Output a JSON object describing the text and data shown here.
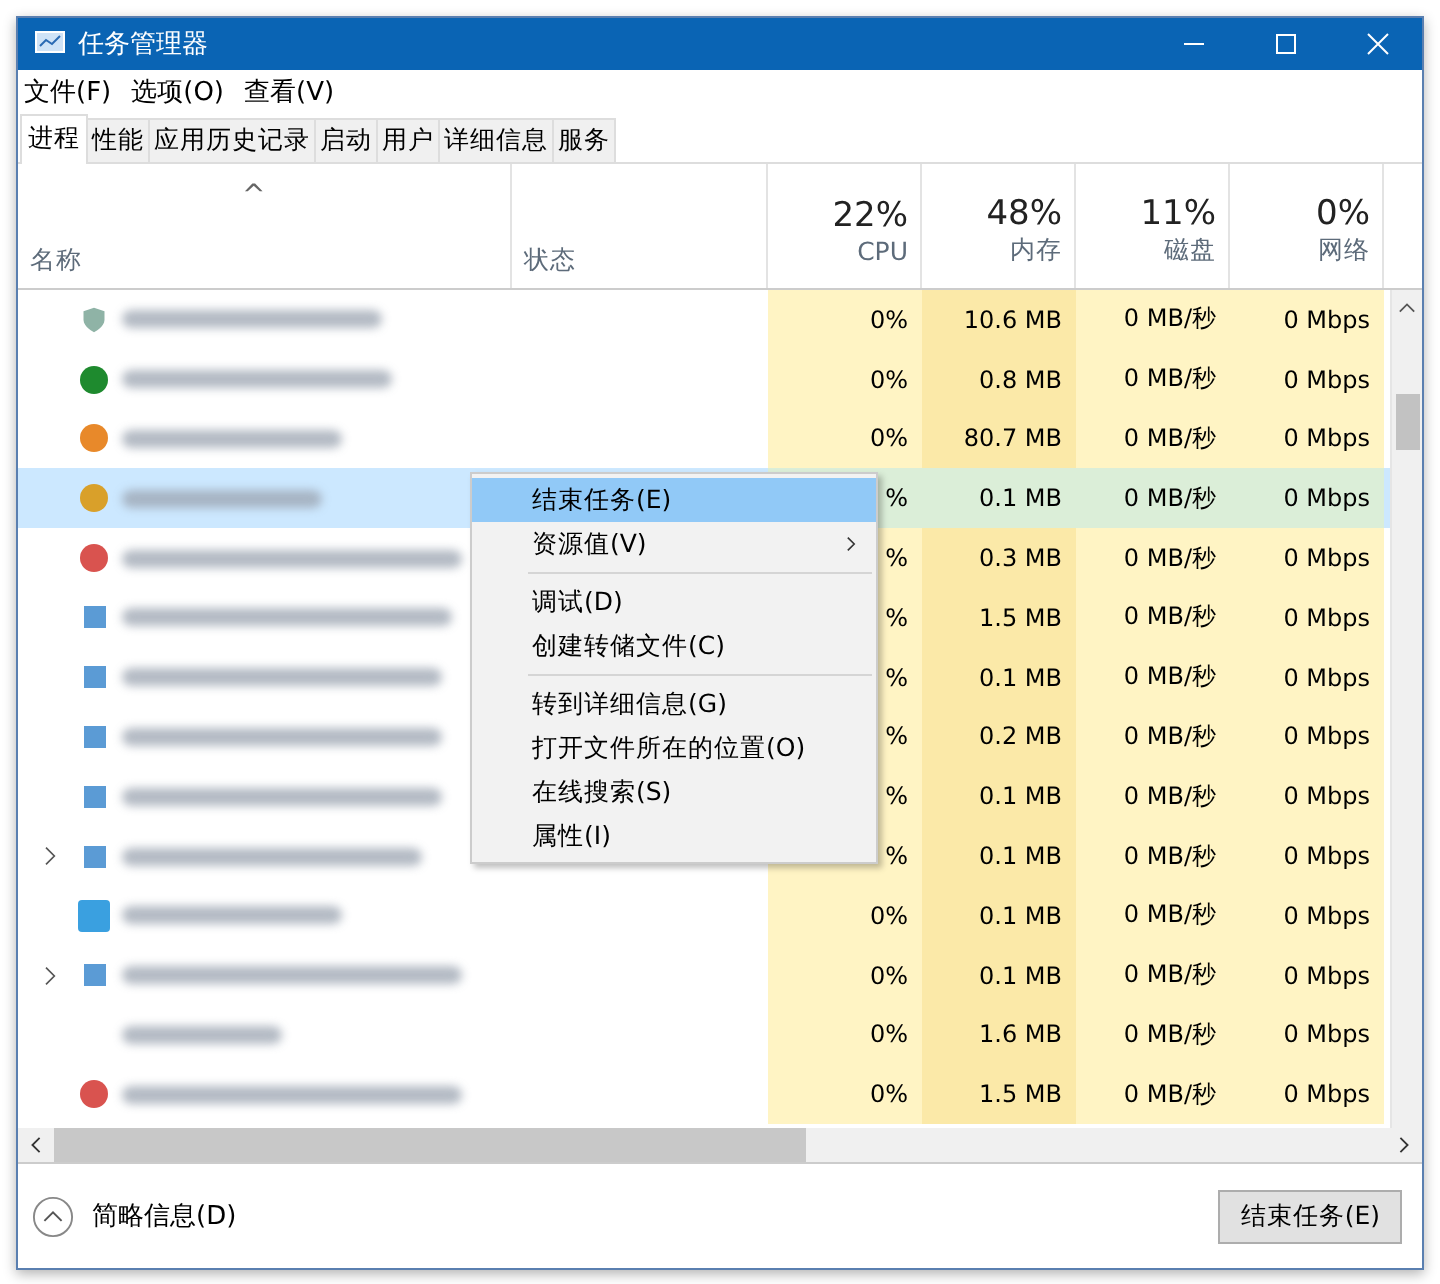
{
  "window": {
    "title": "任务管理器"
  },
  "menu": [
    "文件(F)",
    "选项(O)",
    "查看(V)"
  ],
  "tabs": [
    {
      "label": "进程",
      "selected": true
    },
    {
      "label": "性能",
      "selected": false
    },
    {
      "label": "应用历史记录",
      "selected": false
    },
    {
      "label": "启动",
      "selected": false
    },
    {
      "label": "用户",
      "selected": false
    },
    {
      "label": "详细信息",
      "selected": false
    },
    {
      "label": "服务",
      "selected": false
    }
  ],
  "sort_indicator": "^",
  "columns": [
    {
      "label": "名称"
    },
    {
      "label": "状态"
    },
    {
      "total": "22%",
      "label": "CPU"
    },
    {
      "total": "48%",
      "label": "内存"
    },
    {
      "total": "11%",
      "label": "磁盘"
    },
    {
      "total": "0%",
      "label": "网络"
    }
  ],
  "rows": [
    {
      "expandable": false,
      "selected": false,
      "cpu": "0%",
      "memory": "10.6 MB",
      "disk": "0 MB/秒",
      "network": "0 Mbps"
    },
    {
      "expandable": false,
      "selected": false,
      "cpu": "0%",
      "memory": "0.8 MB",
      "disk": "0 MB/秒",
      "network": "0 Mbps"
    },
    {
      "expandable": false,
      "selected": false,
      "cpu": "0%",
      "memory": "80.7 MB",
      "disk": "0 MB/秒",
      "network": "0 Mbps"
    },
    {
      "expandable": false,
      "selected": true,
      "cpu": "%",
      "memory": "0.1 MB",
      "disk": "0 MB/秒",
      "network": "0 Mbps"
    },
    {
      "expandable": false,
      "selected": false,
      "cpu": "%",
      "memory": "0.3 MB",
      "disk": "0 MB/秒",
      "network": "0 Mbps"
    },
    {
      "expandable": false,
      "selected": false,
      "cpu": "%",
      "memory": "1.5 MB",
      "disk": "0 MB/秒",
      "network": "0 Mbps"
    },
    {
      "expandable": false,
      "selected": false,
      "cpu": "%",
      "memory": "0.1 MB",
      "disk": "0 MB/秒",
      "network": "0 Mbps"
    },
    {
      "expandable": false,
      "selected": false,
      "cpu": "%",
      "memory": "0.2 MB",
      "disk": "0 MB/秒",
      "network": "0 Mbps"
    },
    {
      "expandable": false,
      "selected": false,
      "cpu": "%",
      "memory": "0.1 MB",
      "disk": "0 MB/秒",
      "network": "0 Mbps"
    },
    {
      "expandable": true,
      "selected": false,
      "cpu": "%",
      "memory": "0.1 MB",
      "disk": "0 MB/秒",
      "network": "0 Mbps"
    },
    {
      "expandable": false,
      "selected": false,
      "cpu": "0%",
      "memory": "0.1 MB",
      "disk": "0 MB/秒",
      "network": "0 Mbps"
    },
    {
      "expandable": true,
      "selected": false,
      "cpu": "0%",
      "memory": "0.1 MB",
      "disk": "0 MB/秒",
      "network": "0 Mbps"
    },
    {
      "expandable": false,
      "selected": false,
      "cpu": "0%",
      "memory": "1.6 MB",
      "disk": "0 MB/秒",
      "network": "0 Mbps"
    },
    {
      "expandable": false,
      "selected": false,
      "cpu": "0%",
      "memory": "1.5 MB",
      "disk": "0 MB/秒",
      "network": "0 Mbps"
    }
  ],
  "context_menu": [
    {
      "kind": "item",
      "label": "结束任务(E)",
      "selected": true,
      "submenu": false
    },
    {
      "kind": "item",
      "label": "资源值(V)",
      "selected": false,
      "submenu": true
    },
    {
      "kind": "separator"
    },
    {
      "kind": "item",
      "label": "调试(D)",
      "selected": false,
      "submenu": false
    },
    {
      "kind": "item",
      "label": "创建转储文件(C)",
      "selected": false,
      "submenu": false
    },
    {
      "kind": "separator"
    },
    {
      "kind": "item",
      "label": "转到详细信息(G)",
      "selected": false,
      "submenu": false
    },
    {
      "kind": "item",
      "label": "打开文件所在的位置(O)",
      "selected": false,
      "submenu": false
    },
    {
      "kind": "item",
      "label": "在线搜索(S)",
      "selected": false,
      "submenu": false
    },
    {
      "kind": "item",
      "label": "属性(I)",
      "selected": false,
      "submenu": false
    }
  ],
  "footer": {
    "details_toggle": "简略信息(D)",
    "end_task_button": "结束任务(E)"
  }
}
